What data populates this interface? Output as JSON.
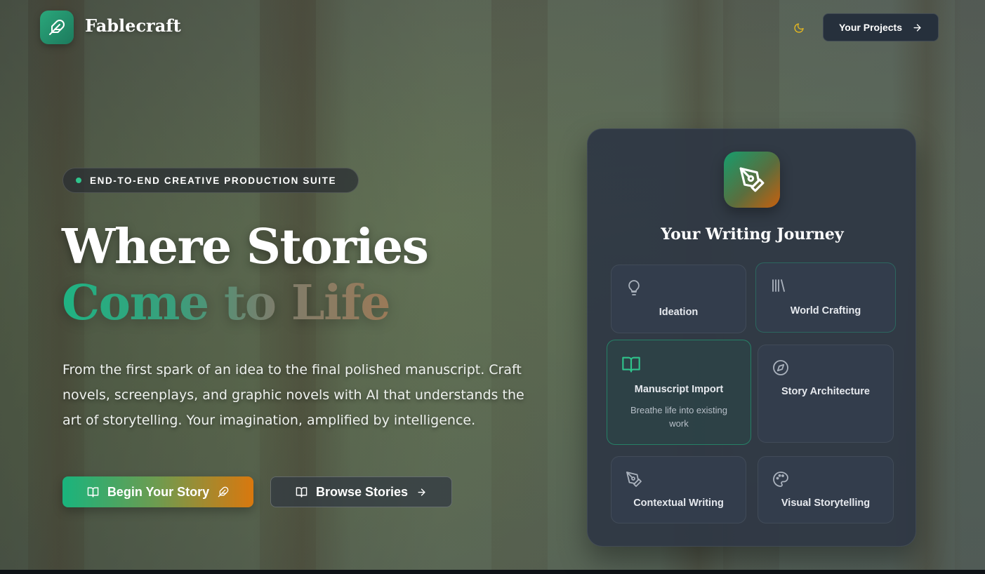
{
  "header": {
    "brand": "Fablecraft",
    "projects_label": "Your Projects"
  },
  "hero": {
    "badge": "END-TO-END CREATIVE PRODUCTION SUITE",
    "title_line1": "Where Stories",
    "title_line2": "Come to Life",
    "description": "From the first spark of an idea to the final polished manuscript. Craft novels, screenplays, and graphic novels with AI that understands the art of storytelling. Your imagination, amplified by intelligence.",
    "primary_button": "Begin Your Story",
    "secondary_button": "Browse Stories"
  },
  "journey": {
    "title": "Your Writing Journey",
    "cards": [
      {
        "title": "Ideation",
        "icon": "lightbulb-icon"
      },
      {
        "title": "World Crafting",
        "icon": "library-icon"
      },
      {
        "title": "Manuscript Import",
        "icon": "open-book-icon",
        "subtitle": "Breathe life into existing work"
      },
      {
        "title": "Story Architecture",
        "icon": "compass-icon"
      },
      {
        "title": "Contextual Writing",
        "icon": "pen-tool-icon"
      },
      {
        "title": "Visual Storytelling",
        "icon": "palette-icon"
      }
    ]
  },
  "colors": {
    "accent_green": "#19b47d",
    "accent_orange": "#d9780e",
    "panel_bg": "#2e3744",
    "theme_icon": "#e6b820"
  }
}
